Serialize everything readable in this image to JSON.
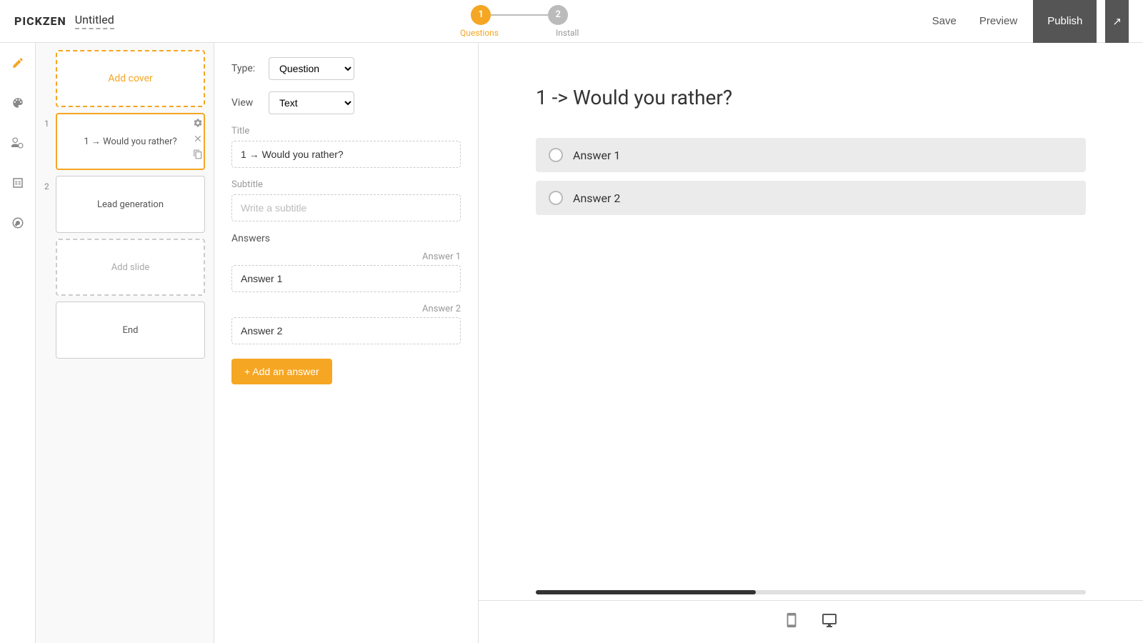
{
  "brand": "PICKZEN",
  "doc_title": "Untitled",
  "steps": [
    {
      "number": "1",
      "label": "Questions",
      "active": true
    },
    {
      "number": "2",
      "label": "Install",
      "active": false
    }
  ],
  "topbar": {
    "save": "Save",
    "preview": "Preview",
    "publish": "Publish"
  },
  "slides": {
    "cover": {
      "label": "Add cover"
    },
    "items": [
      {
        "number": "1",
        "label": "1 → Would you rather?",
        "active": true
      },
      {
        "number": "2",
        "label": "Lead generation",
        "active": false
      }
    ],
    "add_slide": "Add slide",
    "end": "End"
  },
  "edit": {
    "type_label": "Type:",
    "type_value": "Question",
    "view_label": "View",
    "view_value": "Text",
    "title_label": "Title",
    "title_value": "1 → Would you rather?",
    "subtitle_label": "Subtitle",
    "subtitle_placeholder": "Write a subtitle",
    "answers_label": "Answers",
    "answers": [
      {
        "number": "Answer 1",
        "value": "Answer 1"
      },
      {
        "number": "Answer 2",
        "value": "Answer 2"
      }
    ],
    "add_answer_btn": "+ Add an answer"
  },
  "preview": {
    "question": "1 -> Would you rather?",
    "answers": [
      {
        "text": "Answer 1"
      },
      {
        "text": "Answer 2"
      }
    ]
  },
  "icons": {
    "edit": "✎",
    "theme": "◑",
    "connect": "⬡",
    "table": "⊞",
    "settings": "🔧",
    "gear": "⚙",
    "close": "✕",
    "copy": "⧉",
    "mobile": "📱",
    "desktop": "🖥",
    "share": "↗"
  }
}
